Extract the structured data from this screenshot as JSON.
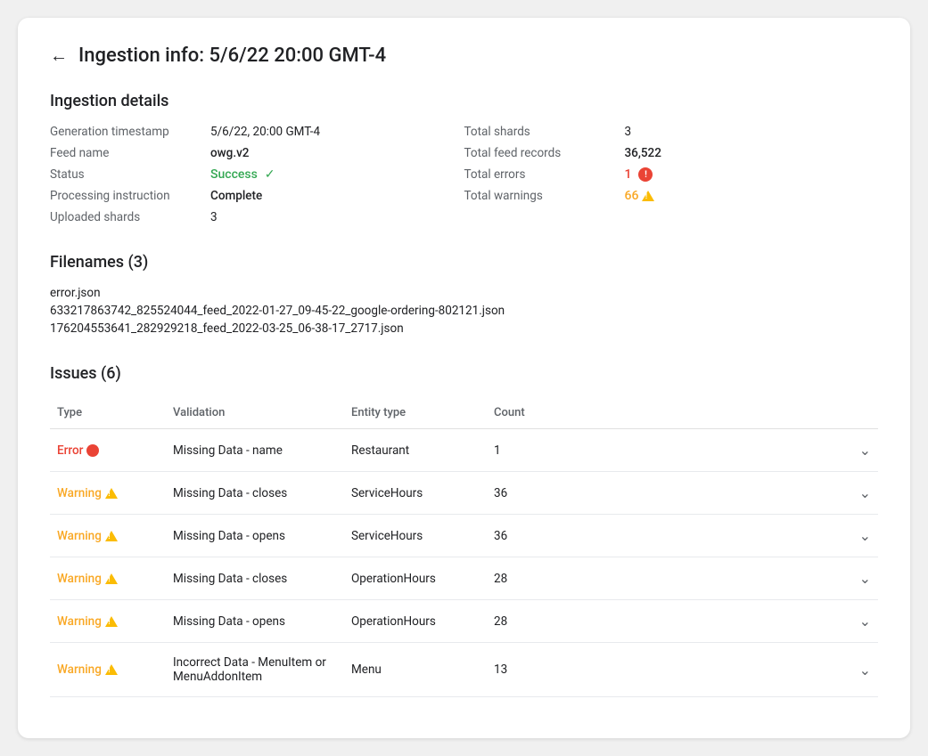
{
  "page": {
    "title": "Ingestion info: 5/6/22 20:00 GMT-4",
    "back_label": "←"
  },
  "ingestion_details": {
    "section_title": "Ingestion details",
    "fields_left": [
      {
        "label": "Generation timestamp",
        "value": "5/6/22, 20:00 GMT-4"
      },
      {
        "label": "Feed name",
        "value": "owg.v2"
      },
      {
        "label": "Status",
        "value": "Success"
      },
      {
        "label": "Processing instruction",
        "value": "Complete"
      },
      {
        "label": "Uploaded shards",
        "value": "3"
      }
    ],
    "fields_right": [
      {
        "label": "Total shards",
        "value": "3"
      },
      {
        "label": "Total feed records",
        "value": "36,522"
      },
      {
        "label": "Total errors",
        "value": "1",
        "type": "error"
      },
      {
        "label": "Total warnings",
        "value": "66",
        "type": "warning"
      }
    ]
  },
  "filenames": {
    "section_title": "Filenames (3)",
    "items": [
      "error.json",
      "633217863742_825524044_feed_2022-01-27_09-45-22_google-ordering-802121.json",
      "176204553641_282929218_feed_2022-03-25_06-38-17_2717.json"
    ]
  },
  "issues": {
    "section_title": "Issues (6)",
    "columns": [
      "Type",
      "Validation",
      "Entity type",
      "Count"
    ],
    "rows": [
      {
        "type": "Error",
        "type_kind": "error",
        "validation": "Missing Data - name",
        "entity_type": "Restaurant",
        "count": "1"
      },
      {
        "type": "Warning",
        "type_kind": "warning",
        "validation": "Missing Data - closes",
        "entity_type": "ServiceHours",
        "count": "36"
      },
      {
        "type": "Warning",
        "type_kind": "warning",
        "validation": "Missing Data - opens",
        "entity_type": "ServiceHours",
        "count": "36"
      },
      {
        "type": "Warning",
        "type_kind": "warning",
        "validation": "Missing Data - closes",
        "entity_type": "OperationHours",
        "count": "28"
      },
      {
        "type": "Warning",
        "type_kind": "warning",
        "validation": "Missing Data - opens",
        "entity_type": "OperationHours",
        "count": "28"
      },
      {
        "type": "Warning",
        "type_kind": "warning",
        "validation": "Incorrect Data - MenuItem or MenuAddonItem",
        "entity_type": "Menu",
        "count": "13"
      }
    ]
  }
}
